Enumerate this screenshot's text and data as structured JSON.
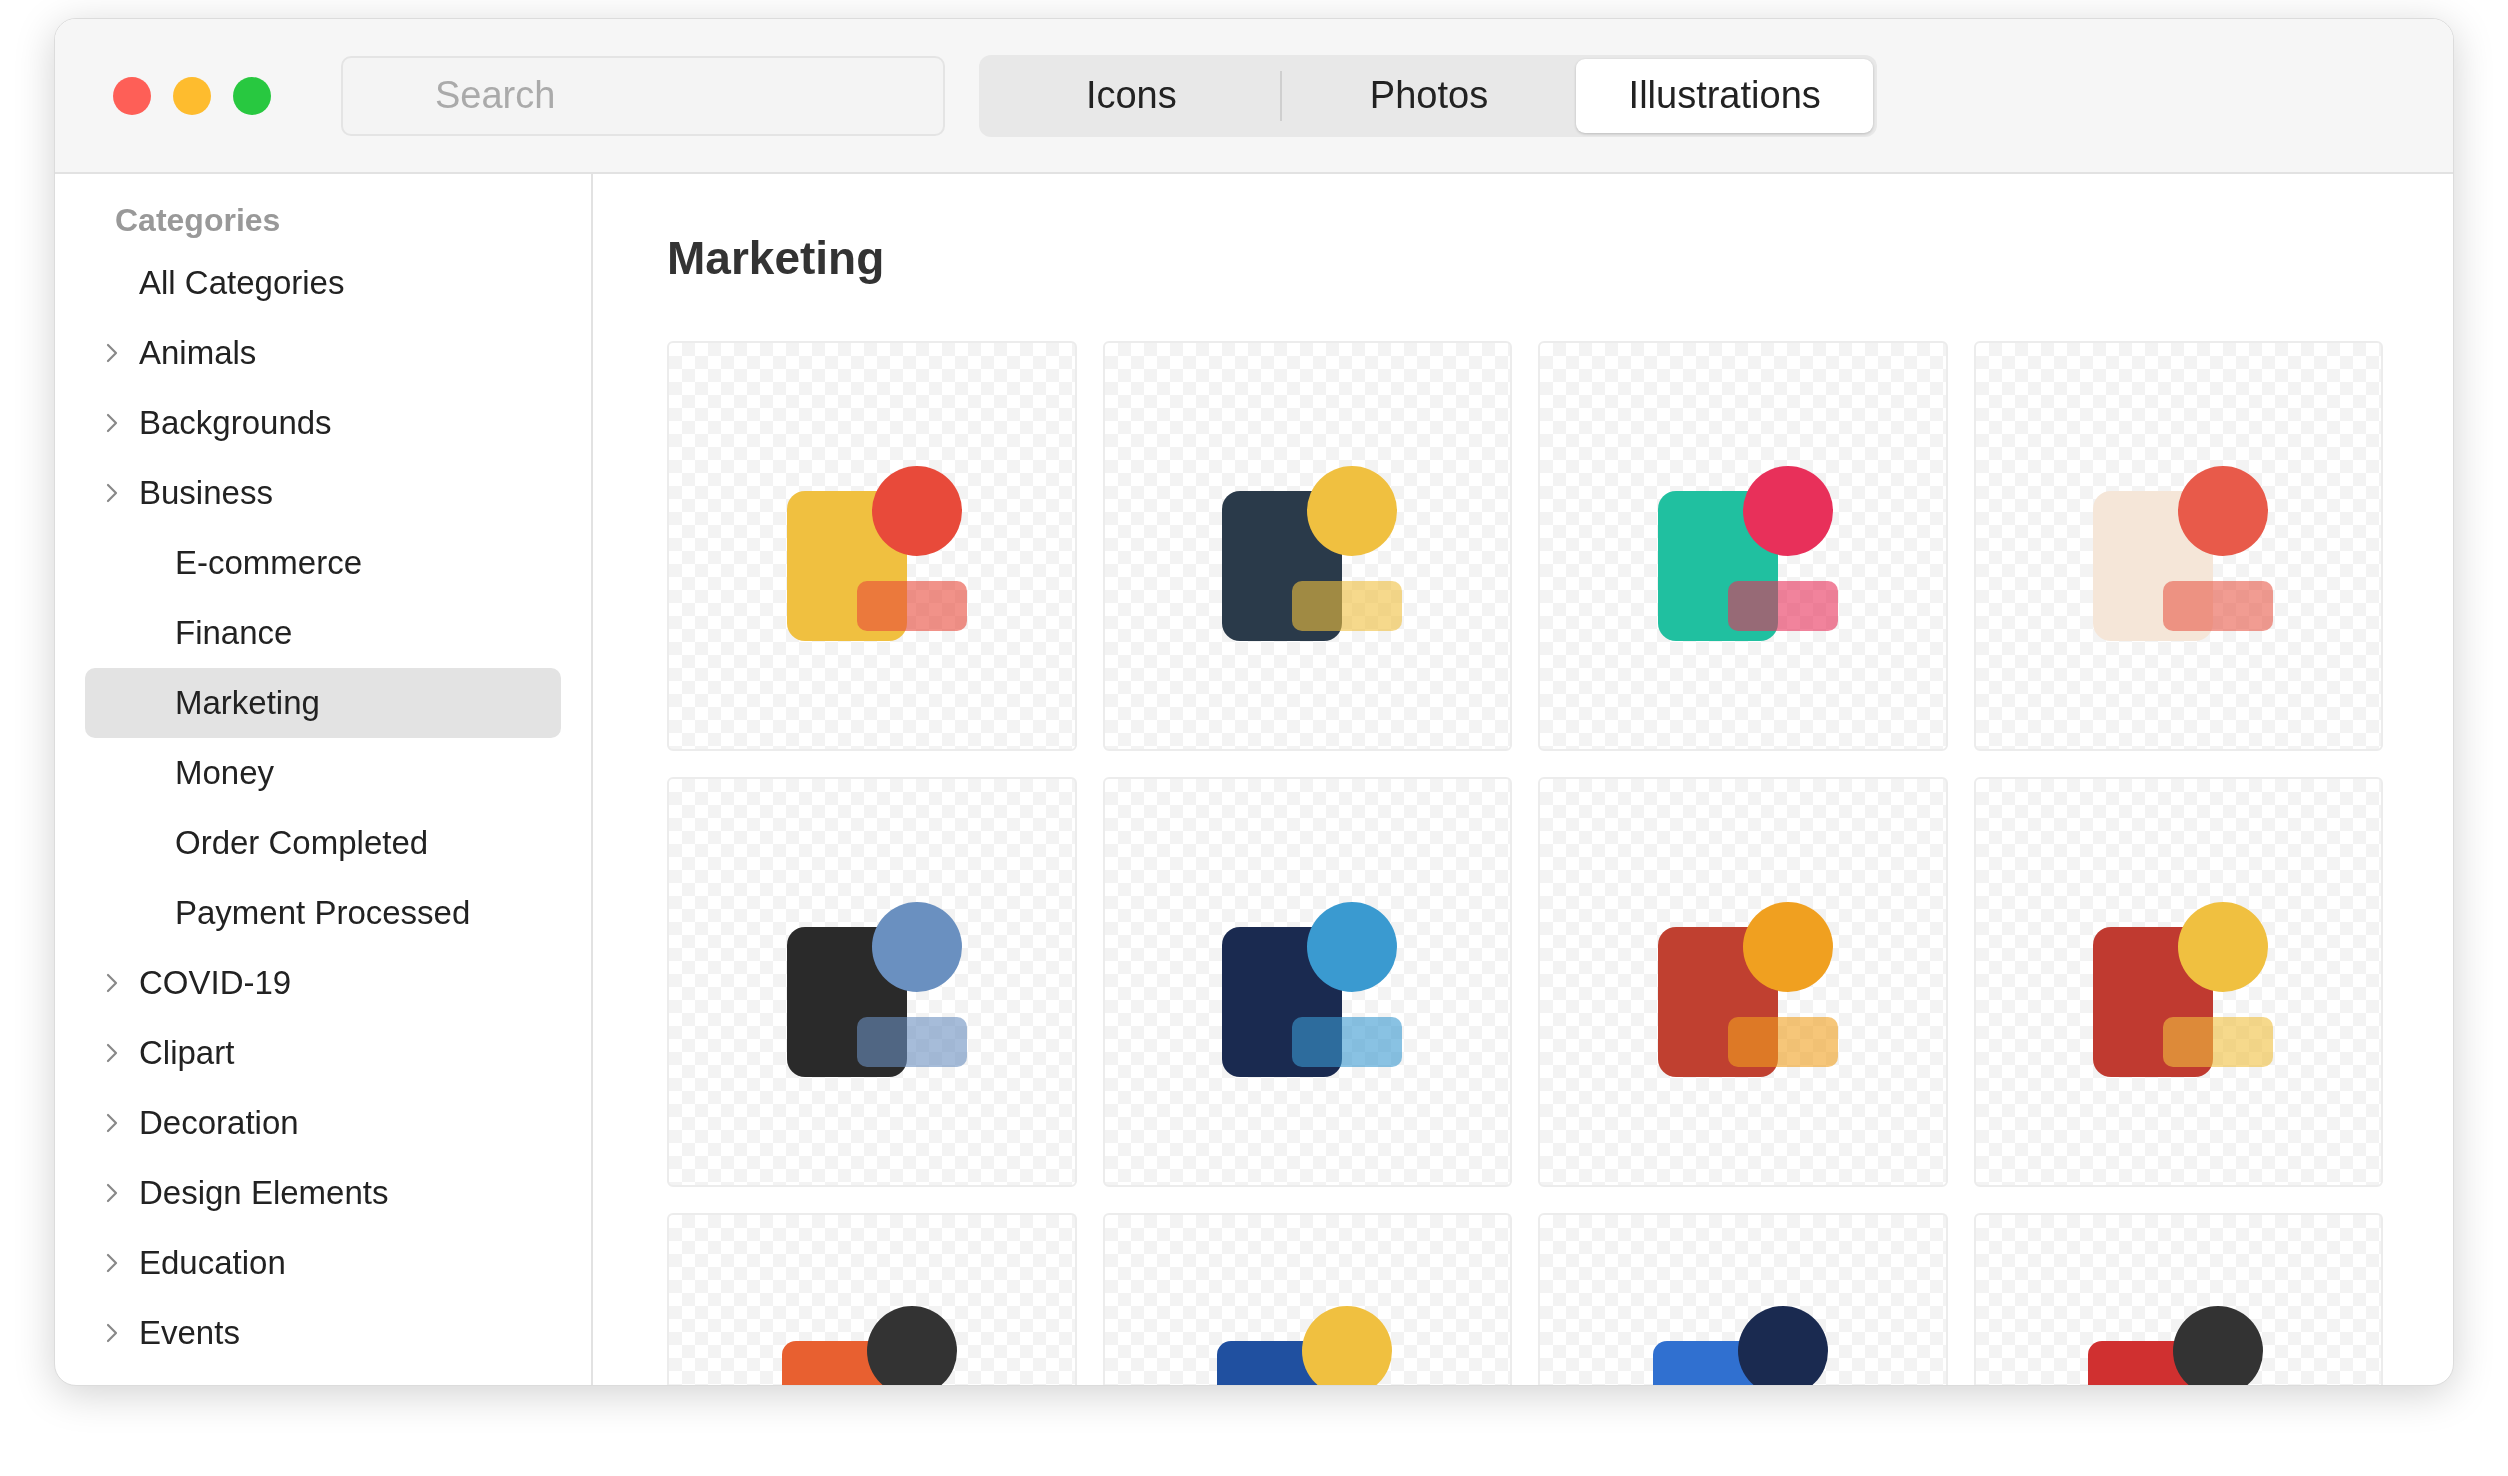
{
  "search": {
    "placeholder": "Search"
  },
  "tabs": [
    {
      "label": "Icons",
      "selected": false
    },
    {
      "label": "Photos",
      "selected": false
    },
    {
      "label": "Illustrations",
      "selected": true
    }
  ],
  "sidebar": {
    "heading": "Categories",
    "items": [
      {
        "label": "All Categories",
        "selected": false
      },
      {
        "label": "Animals",
        "selected": false,
        "expandable": true
      },
      {
        "label": "Backgrounds",
        "selected": false,
        "expandable": true
      },
      {
        "label": "Business",
        "selected": false,
        "expandable": true,
        "children": [
          {
            "label": "E-commerce",
            "selected": false
          },
          {
            "label": "Finance",
            "selected": false
          },
          {
            "label": "Marketing",
            "selected": true
          },
          {
            "label": "Money",
            "selected": false
          },
          {
            "label": "Order Completed",
            "selected": false
          },
          {
            "label": "Payment Processed",
            "selected": false
          }
        ]
      },
      {
        "label": "COVID-19",
        "selected": false,
        "expandable": true
      },
      {
        "label": "Clipart",
        "selected": false,
        "expandable": true
      },
      {
        "label": "Decoration",
        "selected": false,
        "expandable": true
      },
      {
        "label": "Design Elements",
        "selected": false,
        "expandable": true
      },
      {
        "label": "Education",
        "selected": false,
        "expandable": true
      },
      {
        "label": "Events",
        "selected": false,
        "expandable": true
      }
    ]
  },
  "content": {
    "title": "Marketing"
  }
}
